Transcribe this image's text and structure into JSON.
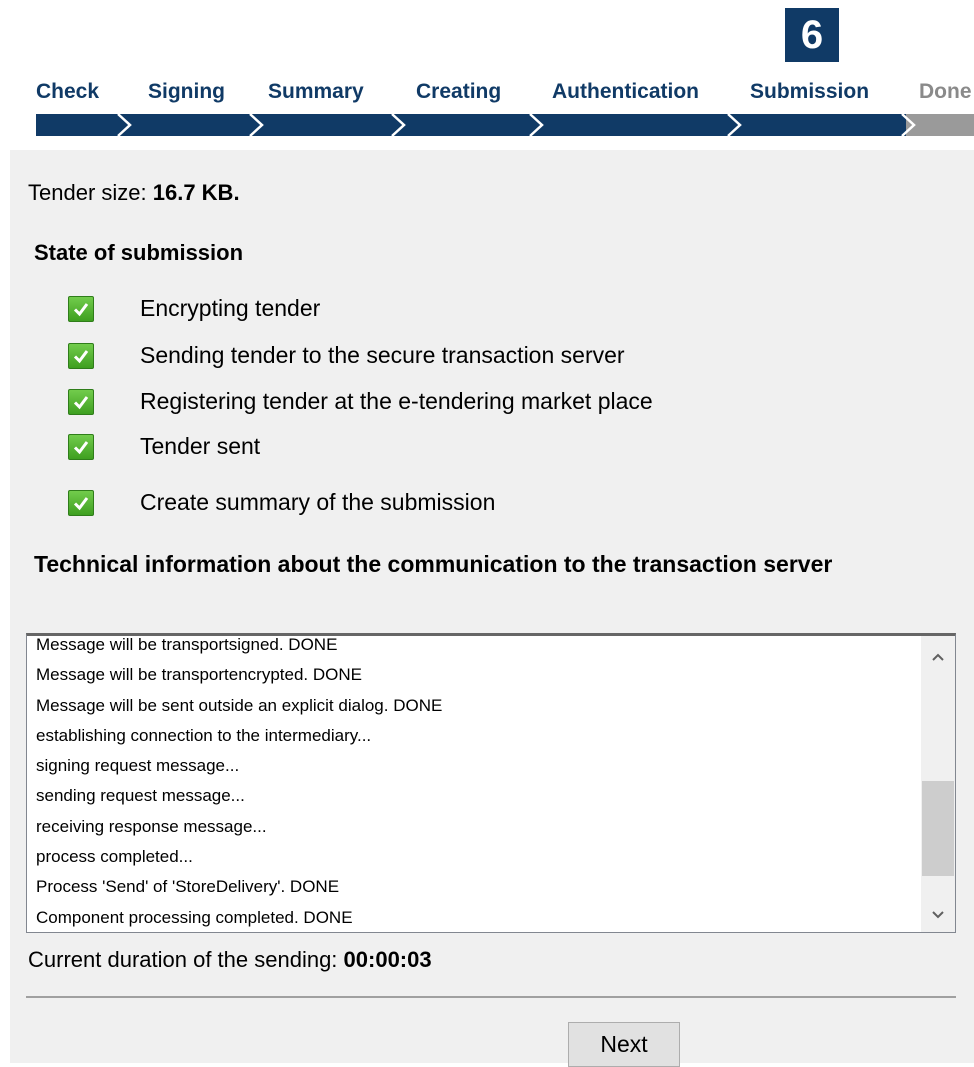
{
  "wizard": {
    "current_step_number": "6",
    "steps": [
      {
        "label": "Check",
        "state": "done"
      },
      {
        "label": "Signing",
        "state": "done"
      },
      {
        "label": "Summary",
        "state": "done"
      },
      {
        "label": "Creating",
        "state": "done"
      },
      {
        "label": "Authentication",
        "state": "done"
      },
      {
        "label": "Submission",
        "state": "current"
      },
      {
        "label": "Done",
        "state": "pending"
      }
    ],
    "colors": {
      "active": "#103a66",
      "inactive": "#8a8a8a"
    }
  },
  "tender": {
    "size_label": "Tender size: ",
    "size_value": "16.7 KB."
  },
  "state_of_submission": {
    "heading": "State of submission",
    "items": [
      {
        "label": "Encrypting tender",
        "icon": "checkmark-icon",
        "checked": true
      },
      {
        "label": "Sending tender to the secure transaction server",
        "icon": "checkmark-icon",
        "checked": true
      },
      {
        "label": "Registering tender at the e-tendering market place",
        "icon": "checkmark-icon",
        "checked": true
      },
      {
        "label": "Tender sent",
        "icon": "checkmark-icon",
        "checked": true
      },
      {
        "label": "Create summary of the submission",
        "icon": "checkmark-icon",
        "checked": true
      }
    ]
  },
  "technical_info": {
    "heading": "Technical information about the communication to the transaction server",
    "log": [
      "Message will be transportsigned. DONE",
      "Message will be transportencrypted. DONE",
      "Message will be sent outside an explicit dialog. DONE",
      "establishing connection to the intermediary...",
      "signing request message...",
      "sending request message...",
      "receiving response message...",
      "process completed...",
      "Process 'Send' of 'StoreDelivery'. DONE",
      "Component processing completed. DONE"
    ]
  },
  "duration": {
    "label": "Current duration of the sending: ",
    "value": "00:00:03"
  },
  "footer": {
    "next_label": "Next"
  }
}
